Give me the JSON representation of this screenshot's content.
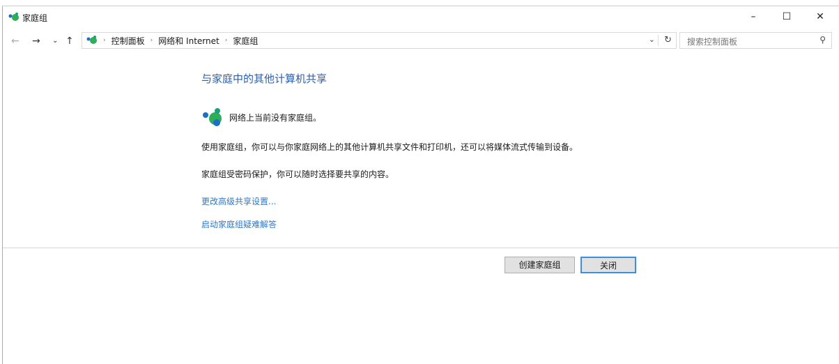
{
  "window": {
    "title": "家庭组",
    "minimize": "–",
    "maximize": "☐",
    "close": "✕"
  },
  "nav": {
    "back": "←",
    "forward": "→",
    "recent": "⌄",
    "up": "↑"
  },
  "breadcrumb": [
    "控制面板",
    "网络和 Internet",
    "家庭组"
  ],
  "search": {
    "placeholder": "搜索控制面板"
  },
  "main": {
    "heading": "与家庭中的其他计算机共享",
    "status": "网络上当前没有家庭组。",
    "desc1": "使用家庭组，你可以与你家庭网络上的其他计算机共享文件和打印机，还可以将媒体流式传输到设备。",
    "desc2": "家庭组受密码保护，你可以随时选择要共享的内容。",
    "link1": "更改高级共享设置...",
    "link2": "启动家庭组疑难解答"
  },
  "buttons": {
    "create": "创建家庭组",
    "close": "关闭"
  }
}
